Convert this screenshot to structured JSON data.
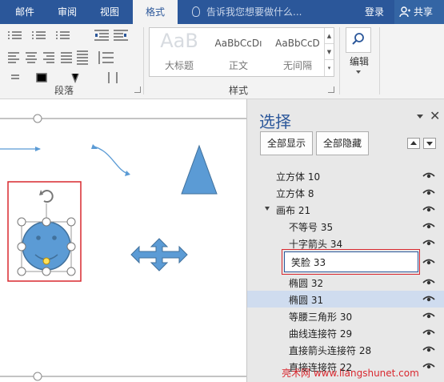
{
  "ribbon_tabs": [
    {
      "label": "邮件"
    },
    {
      "label": "审阅"
    },
    {
      "label": "视图"
    },
    {
      "label": "格式"
    }
  ],
  "tell_me": "告诉我您想要做什么...",
  "login": "登录",
  "share": "共享",
  "groups": {
    "paragraph": "段落",
    "styles": "样式",
    "editing": "编辑"
  },
  "styles": [
    {
      "sample": "AaB",
      "name": "大标题"
    },
    {
      "sample": "AaBbCcDı",
      "name": "正文"
    },
    {
      "sample": "AaBbCcD",
      "name": "无间隔"
    }
  ],
  "pane": {
    "title": "选择",
    "show_all": "全部显示",
    "hide_all": "全部隐藏",
    "items": [
      {
        "label": "立方体 10",
        "level": 0,
        "highlighted": false
      },
      {
        "label": "立方体 8",
        "level": 0,
        "highlighted": false
      },
      {
        "label": "画布 21",
        "level": 0,
        "highlighted": false,
        "expanded": true
      },
      {
        "label": "不等号 35",
        "level": 1,
        "highlighted": false
      },
      {
        "label": "十字箭头 34",
        "level": 1,
        "highlighted": false
      },
      {
        "label": "笑脸 33",
        "level": 1,
        "highlighted": false,
        "editing": true
      },
      {
        "label": "椭圆 32",
        "level": 1,
        "highlighted": false
      },
      {
        "label": "椭圆 31",
        "level": 1,
        "highlighted": true
      },
      {
        "label": "等腰三角形 30",
        "level": 1,
        "highlighted": false
      },
      {
        "label": "曲线连接符 29",
        "level": 1,
        "highlighted": false
      },
      {
        "label": "直接箭头连接符 28",
        "level": 1,
        "highlighted": false
      },
      {
        "label": "直接连接符 22",
        "level": 1,
        "highlighted": false
      }
    ]
  },
  "watermark": "亮术网 www.liangshunet.com",
  "colors": {
    "accent": "#2b579a",
    "shape_fill": "#5b9bd5",
    "highlight": "#cfdcef",
    "callout_red": "#d9282f"
  }
}
